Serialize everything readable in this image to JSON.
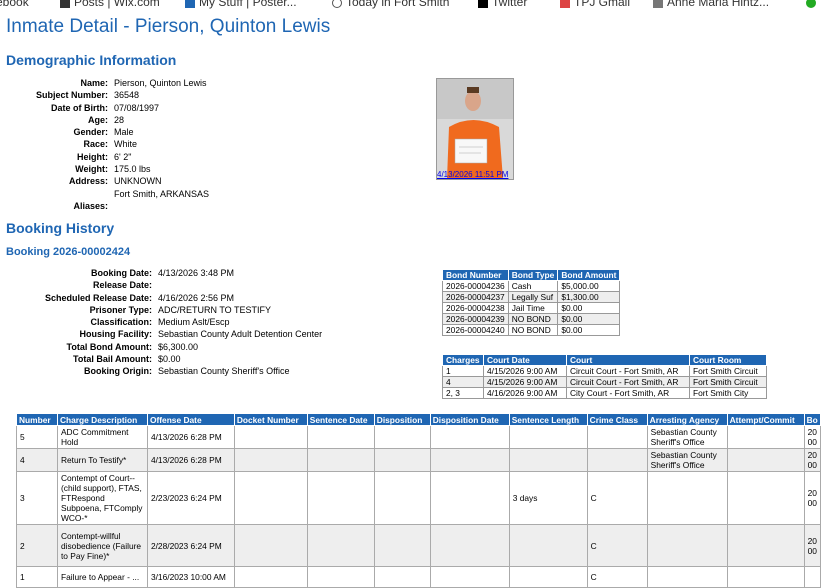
{
  "bookmarks": [
    {
      "label": "ebook",
      "icon": "none"
    },
    {
      "label": "Posts | Wix.com",
      "icon": "wix-icon"
    },
    {
      "label": "My Stuff | Poster...",
      "icon": "poster-icon"
    },
    {
      "label": "Today in Fort Smith",
      "icon": "globe-icon"
    },
    {
      "label": "Twitter",
      "icon": "x-icon"
    },
    {
      "label": "TPJ Gmail",
      "icon": "gmail-icon"
    },
    {
      "label": "Anne Maria Hintz...",
      "icon": "image-icon"
    }
  ],
  "page": {
    "title": "Inmate Detail - Pierson, Quinton Lewis"
  },
  "demographic": {
    "heading": "Demographic Information",
    "fields": [
      {
        "label": "Name:",
        "value": "Pierson, Quinton Lewis"
      },
      {
        "label": "Subject Number:",
        "value": "36548"
      },
      {
        "label": "Date of Birth:",
        "value": "07/08/1997"
      },
      {
        "label": "Age:",
        "value": "28"
      },
      {
        "label": "Gender:",
        "value": "Male"
      },
      {
        "label": "Race:",
        "value": "White"
      },
      {
        "label": "Height:",
        "value": "6' 2\""
      },
      {
        "label": "Weight:",
        "value": "175.0 lbs"
      },
      {
        "label": "Address:",
        "value": "UNKNOWN",
        "value2": "Fort Smith, ARKANSAS"
      },
      {
        "label": "Aliases:",
        "value": ""
      }
    ],
    "photo_link": "4/13/2026 11:51 PM"
  },
  "booking_history": {
    "heading": "Booking History",
    "booking_title": "Booking 2026-00002424",
    "fields": [
      {
        "label": "Booking Date:",
        "value": "4/13/2026 3:48 PM"
      },
      {
        "label": "Release Date:",
        "value": ""
      },
      {
        "label": "Scheduled Release Date:",
        "value": "4/16/2026 2:56 PM"
      },
      {
        "label": "Prisoner Type:",
        "value": "ADC/RETURN TO TESTIFY"
      },
      {
        "label": "Classification:",
        "value": "Medium Aslt/Escp"
      },
      {
        "label": "Housing Facility:",
        "value": "Sebastian County Adult Detention Center"
      },
      {
        "label": "Total Bond Amount:",
        "value": "$6,300.00"
      },
      {
        "label": "Total Bail Amount:",
        "value": "$0.00"
      },
      {
        "label": "Booking Origin:",
        "value": "Sebastian County Sheriff's Office"
      }
    ]
  },
  "bonds": {
    "headers": [
      "Bond Number",
      "Bond Type",
      "Bond Amount"
    ],
    "rows": [
      [
        "2026-00004236",
        "Cash",
        "$5,000.00"
      ],
      [
        "2026-00004237",
        "Legally Suf",
        "$1,300.00"
      ],
      [
        "2026-00004238",
        "Jail Time",
        "$0.00"
      ],
      [
        "2026-00004239",
        "NO BOND",
        "$0.00"
      ],
      [
        "2026-00004240",
        "NO BOND",
        "$0.00"
      ]
    ]
  },
  "courts": {
    "headers": [
      "Charges",
      "Court Date",
      "Court",
      "Court Room"
    ],
    "rows": [
      [
        "1",
        "4/15/2026 9:00 AM",
        "Circuit Court - Fort Smith, AR",
        "Fort Smith Circuit"
      ],
      [
        "4",
        "4/15/2026 9:00 AM",
        "Circuit Court - Fort Smith, AR",
        "Fort Smith Circuit"
      ],
      [
        "2, 3",
        "4/16/2026 9:00 AM",
        "City Court - Fort Smith, AR",
        "Fort Smith City"
      ]
    ]
  },
  "charges": {
    "headers": [
      "Number",
      "Charge Description",
      "Offense Date",
      "Docket Number",
      "Sentence Date",
      "Disposition",
      "Disposition Date",
      "Sentence Length",
      "Crime Class",
      "Arresting Agency",
      "Attempt/Commit",
      "Bo"
    ],
    "rows": [
      [
        "5",
        "ADC Commitment Hold",
        "4/13/2026 6:28 PM",
        "",
        "",
        "",
        "",
        "",
        "",
        "Sebastian County Sheriff's Office",
        "",
        "20 00"
      ],
      [
        "4",
        "Return To Testify*",
        "4/13/2026 6:28 PM",
        "",
        "",
        "",
        "",
        "",
        "",
        "Sebastian County Sheriff's Office",
        "",
        "20 00"
      ],
      [
        "3",
        "Contempt of Court--(child support), FTAS, FTRespond Subpoena, FTComply WCO-*",
        "2/23/2023 6:24 PM",
        "",
        "",
        "",
        "",
        "3 days",
        "C",
        "",
        "",
        "20 00"
      ],
      [
        "2",
        "Contempt-willful disobedience (Failure to Pay Fine)*",
        "2/28/2023 6:24 PM",
        "",
        "",
        "",
        "",
        "",
        "C",
        "",
        "",
        "20 00"
      ],
      [
        "1",
        "Failure to Appear - ...",
        "3/16/2023 10:00 AM",
        "",
        "",
        "",
        "",
        "",
        "C",
        "",
        "",
        ""
      ]
    ]
  }
}
